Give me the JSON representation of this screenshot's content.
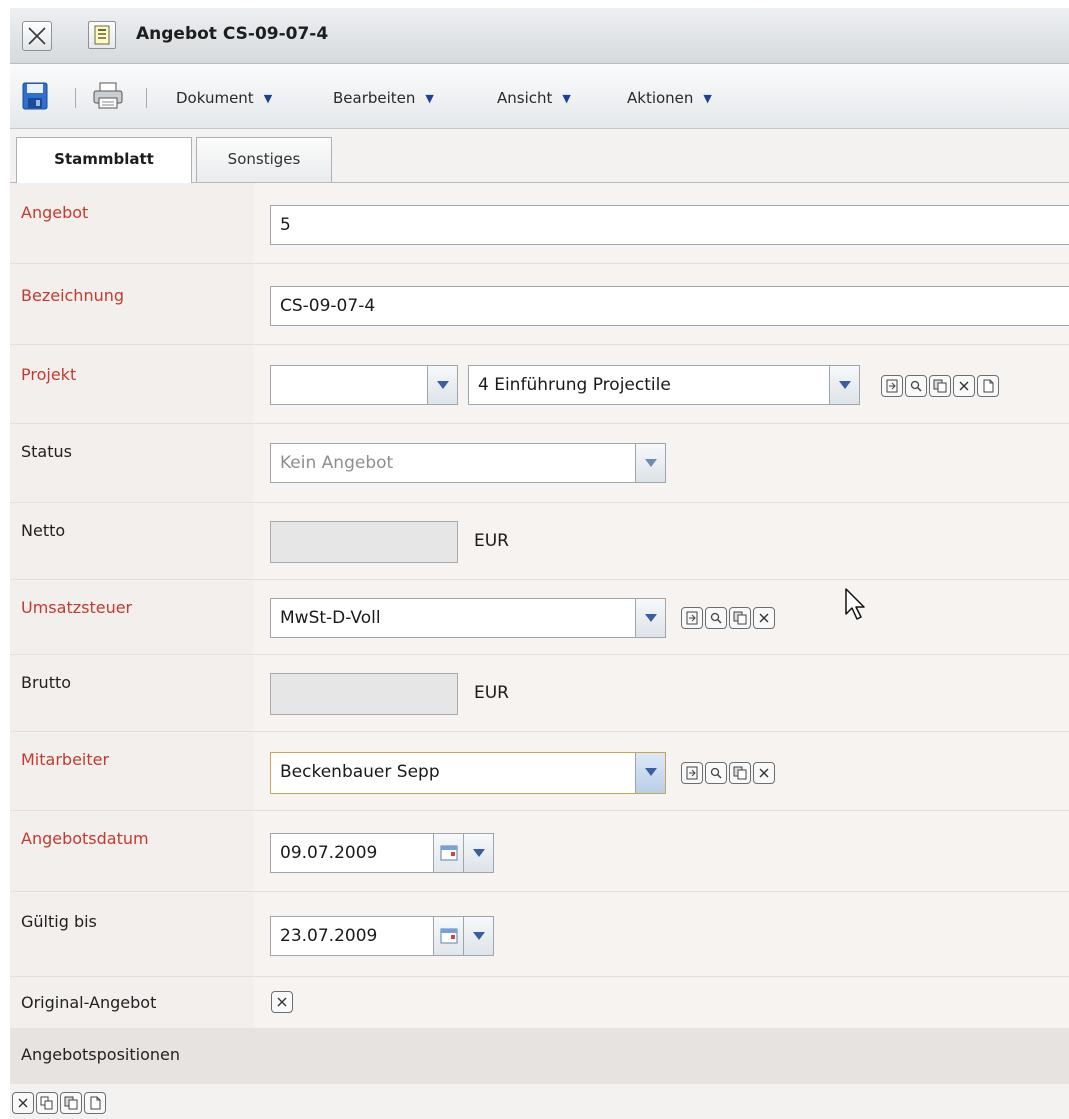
{
  "window": {
    "title": "Angebot CS-09-07-4"
  },
  "toolbar": {
    "menus": [
      {
        "label": "Dokument"
      },
      {
        "label": "Bearbeiten"
      },
      {
        "label": "Ansicht"
      },
      {
        "label": "Aktionen"
      }
    ],
    "caret": "▼"
  },
  "tabs": [
    {
      "label": "Stammblatt",
      "active": true
    },
    {
      "label": "Sonstiges",
      "active": false
    }
  ],
  "form": {
    "angebot": {
      "label": "Angebot",
      "value": "5"
    },
    "bezeichnung": {
      "label": "Bezeichnung",
      "value": "CS-09-07-4"
    },
    "projekt": {
      "label": "Projekt",
      "value_short": "",
      "value": "4 Einführung Projectile"
    },
    "status": {
      "label": "Status",
      "value": "Kein Angebot"
    },
    "netto": {
      "label": "Netto",
      "value": "",
      "unit": "EUR"
    },
    "umsatzsteuer": {
      "label": "Umsatzsteuer",
      "value": "MwSt-D-Voll"
    },
    "brutto": {
      "label": "Brutto",
      "value": "",
      "unit": "EUR"
    },
    "mitarbeiter": {
      "label": "Mitarbeiter",
      "value": "Beckenbauer Sepp"
    },
    "angebotsdatum": {
      "label": "Angebotsdatum",
      "value": "09.07.2009"
    },
    "gueltig_bis": {
      "label": "Gültig bis",
      "value": "23.07.2009"
    },
    "original_angebot": {
      "label": "Original-Angebot"
    }
  },
  "section": {
    "label": "Angebotspositionen"
  },
  "colors": {
    "required_label": "#c23b30",
    "accent_blue": "#1f3f8f"
  }
}
